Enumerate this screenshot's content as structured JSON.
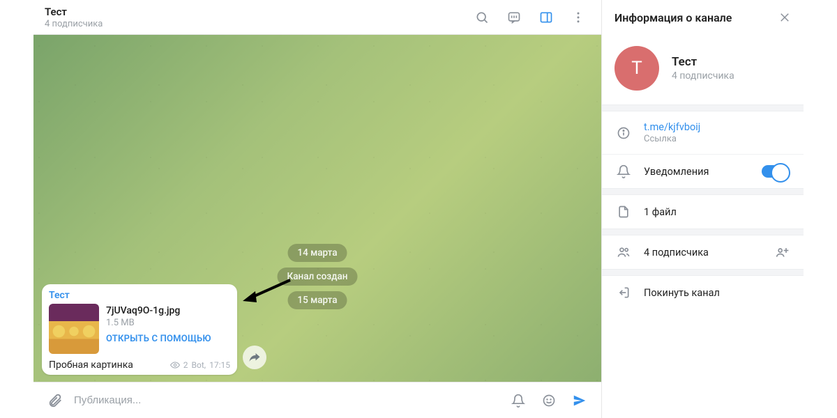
{
  "header": {
    "title": "Тест",
    "subscribers": "4 подписчика"
  },
  "chat": {
    "service": {
      "date1": "14 марта",
      "created": "Канал создан",
      "date2": "15 марта"
    },
    "message": {
      "sender": "Тест",
      "filename": "7jUVaq9O-1g.jpg",
      "filesize": "1.5 MB",
      "open_with": "ОТКРЫТЬ С ПОМОЩЬЮ",
      "caption": "Пробная картинка",
      "views": "2",
      "author": "Bot,",
      "time": "17:15"
    }
  },
  "composer": {
    "placeholder": "Публикация..."
  },
  "info": {
    "title": "Информация о канале",
    "name": "Тест",
    "subscribers": "4 подписчика",
    "avatar_letter": "Т",
    "link": "t.me/kjfvboij",
    "link_label": "Ссылка",
    "notifications": "Уведомления",
    "files": "1 файл",
    "members": "4 подписчика",
    "leave": "Покинуть канал"
  }
}
